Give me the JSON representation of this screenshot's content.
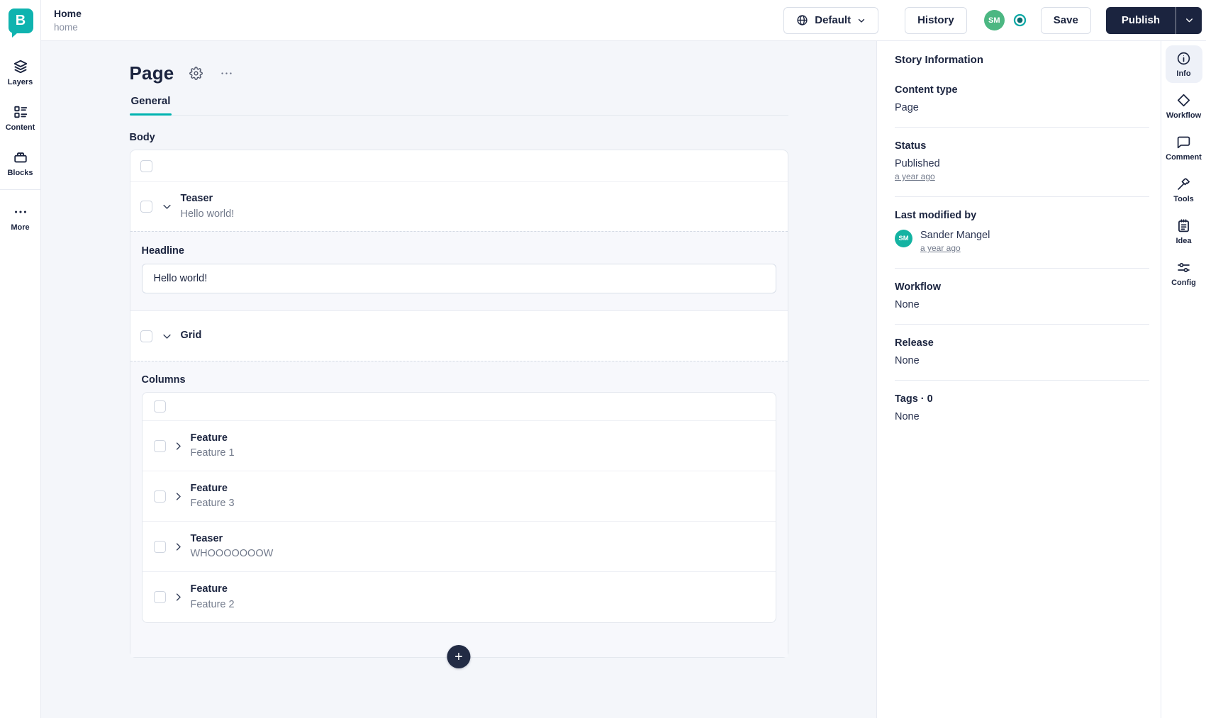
{
  "topbar": {
    "logo_letter": "B",
    "story_title": "Home",
    "story_slug": "home",
    "language_label": "Default",
    "history_label": "History",
    "user_initials": "SM",
    "save_label": "Save",
    "publish_label": "Publish"
  },
  "left_nav": {
    "items": [
      {
        "label": "Layers"
      },
      {
        "label": "Content"
      },
      {
        "label": "Blocks"
      },
      {
        "label": "More"
      }
    ]
  },
  "editor": {
    "page_title": "Page",
    "tab_general": "General",
    "body_label": "Body",
    "teaser_block": {
      "title": "Teaser",
      "subtitle": "Hello world!"
    },
    "headline_label": "Headline",
    "headline_value": "Hello world!",
    "grid_block": {
      "title": "Grid"
    },
    "columns_label": "Columns",
    "column_rows": [
      {
        "title": "Feature",
        "subtitle": "Feature 1"
      },
      {
        "title": "Feature",
        "subtitle": "Feature 3"
      },
      {
        "title": "Teaser",
        "subtitle": "WHOOOOOOOW"
      },
      {
        "title": "Feature",
        "subtitle": "Feature 2"
      }
    ],
    "add_block_label": "+"
  },
  "story_info": {
    "title": "Story Information",
    "content_type_label": "Content type",
    "content_type_value": "Page",
    "status_label": "Status",
    "status_value": "Published",
    "status_time": "a year ago",
    "modified_label": "Last modified by",
    "modified_initials": "SM",
    "modified_name": "Sander Mangel",
    "modified_time": "a year ago",
    "workflow_label": "Workflow",
    "workflow_value": "None",
    "release_label": "Release",
    "release_value": "None",
    "tags_label": "Tags · 0",
    "tags_value": "None"
  },
  "right_nav": {
    "items": [
      {
        "label": "Info"
      },
      {
        "label": "Workflow"
      },
      {
        "label": "Comment"
      },
      {
        "label": "Tools"
      },
      {
        "label": "Idea"
      },
      {
        "label": "Config"
      }
    ]
  },
  "colors": {
    "accent_teal": "#00b3b0",
    "brand_navy": "#1b243f",
    "avatar_green": "#4cb782",
    "avatar_teal": "#14b3a2"
  }
}
